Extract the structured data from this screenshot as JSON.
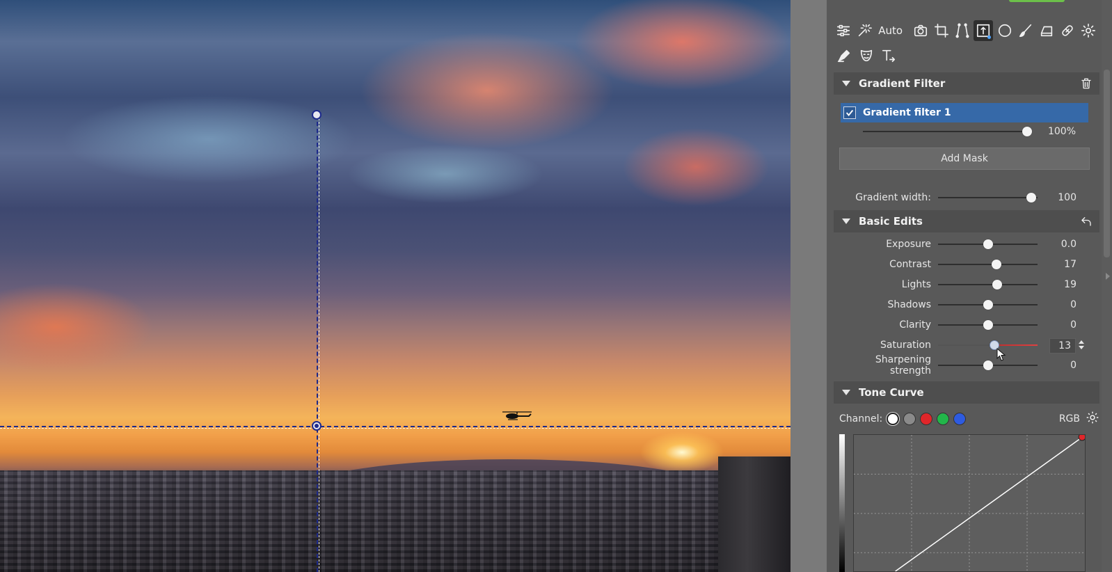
{
  "toolbar": {
    "auto_label": "Auto",
    "row1_icons": [
      "adjustments-icon",
      "magic-wand-icon",
      "camera-icon",
      "crop-icon",
      "perspective-icon",
      "gradient-filter-icon",
      "radial-filter-icon",
      "brush-icon",
      "eraser-icon",
      "healing-icon",
      "gear-icon"
    ],
    "row2_icons": [
      "pen-icon",
      "mask-face-icon",
      "text-icon"
    ]
  },
  "gradient_filter": {
    "title": "Gradient Filter",
    "layer_name": "Gradient filter 1",
    "layer_checked": true,
    "opacity": {
      "value_label": "100%",
      "fraction": 1.0
    },
    "add_mask_label": "Add Mask",
    "gradient_width": {
      "label": "Gradient width:",
      "value": "100",
      "fraction": 0.94
    }
  },
  "basic_edits": {
    "title": "Basic Edits",
    "sliders": [
      {
        "label": "Exposure",
        "value": "0.0",
        "fraction": 0.5
      },
      {
        "label": "Contrast",
        "value": "17",
        "fraction": 0.585
      },
      {
        "label": "Lights",
        "value": "19",
        "fraction": 0.595
      },
      {
        "label": "Shadows",
        "value": "0",
        "fraction": 0.5
      },
      {
        "label": "Clarity",
        "value": "0",
        "fraction": 0.5
      },
      {
        "label": "Saturation",
        "value": "13",
        "fraction": 0.565
      },
      {
        "label": "Sharpening strength",
        "value": "0",
        "fraction": 0.5
      }
    ]
  },
  "tone_curve": {
    "title": "Tone Curve",
    "channel_label": "Channel:",
    "channels": [
      "white",
      "gray",
      "red",
      "green",
      "blue"
    ],
    "selected_channel": "white",
    "mode_label": "RGB"
  },
  "colors": {
    "panel": "#595959",
    "section_header": "#4e4e4e",
    "selected_layer": "#3669a8",
    "guide_line": "#1e2a8c",
    "accent_green": "#6cc04a"
  }
}
